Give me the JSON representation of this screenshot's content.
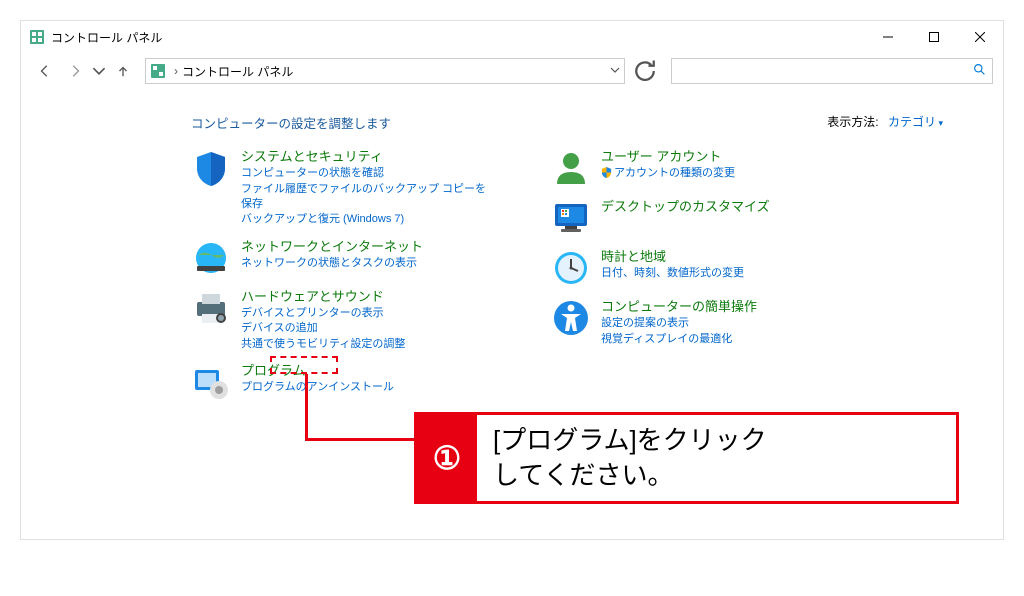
{
  "window": {
    "title": "コントロール パネル"
  },
  "nav": {
    "breadcrumb": "コントロール パネル"
  },
  "main": {
    "heading": "コンピューターの設定を調整します",
    "viewby_label": "表示方法:",
    "viewby_value": "カテゴリ"
  },
  "left": [
    {
      "title": "システムとセキュリティ",
      "links": [
        "コンピューターの状態を確認",
        "ファイル履歴でファイルのバックアップ コピーを保存",
        "バックアップと復元 (Windows 7)"
      ]
    },
    {
      "title": "ネットワークとインターネット",
      "links": [
        "ネットワークの状態とタスクの表示"
      ]
    },
    {
      "title": "ハードウェアとサウンド",
      "links": [
        "デバイスとプリンターの表示",
        "デバイスの追加",
        "共通で使うモビリティ設定の調整"
      ]
    },
    {
      "title": "プログラム",
      "links": [
        "プログラムのアンインストール"
      ]
    }
  ],
  "right": [
    {
      "title": "ユーザー アカウント",
      "links": [
        "アカウントの種類の変更"
      ],
      "shield": [
        true
      ]
    },
    {
      "title": "デスクトップのカスタマイズ",
      "links": []
    },
    {
      "title": "時計と地域",
      "links": [
        "日付、時刻、数値形式の変更"
      ]
    },
    {
      "title": "コンピューターの簡単操作",
      "links": [
        "設定の提案の表示",
        "視覚ディスプレイの最適化"
      ]
    }
  ],
  "callout": {
    "num": "①",
    "text_line1": "[プログラム]をクリック",
    "text_line2": "してください。"
  }
}
